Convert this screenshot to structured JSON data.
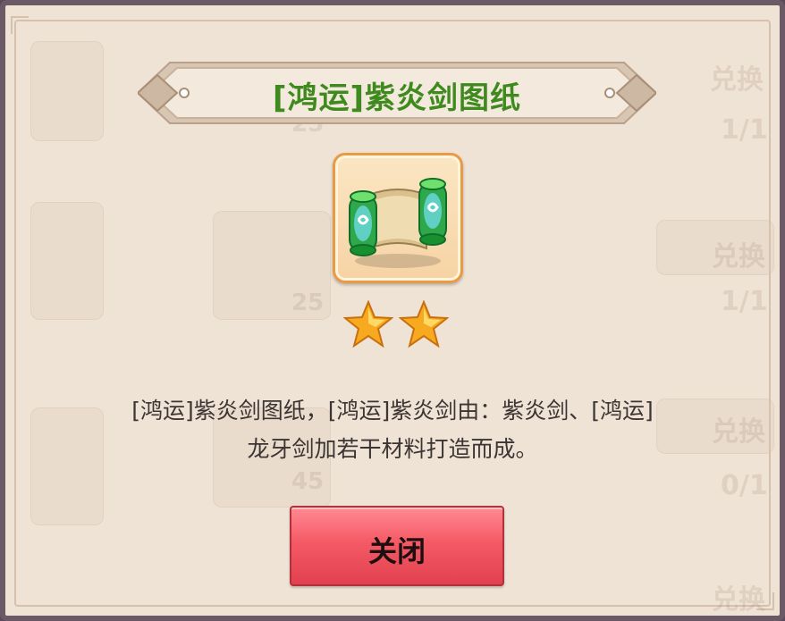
{
  "dialog": {
    "title": "[鸿运]紫炎剑图纸",
    "stars": 2,
    "description_line1": "[鸿运]紫炎剑图纸，[鸿运]紫炎剑由：紫炎剑、[鸿运]",
    "description_line2": "龙牙剑加若干材料打造而成。",
    "close_label": "关闭"
  },
  "background": {
    "exchange_labels": [
      "兑换",
      "兑换",
      "兑换",
      "兑换"
    ],
    "counts": [
      "1/1",
      "1/1",
      "0/1"
    ],
    "numbers": [
      "25",
      "25",
      "45"
    ]
  },
  "colors": {
    "title": "#3f8a1e",
    "button": "#f45a65",
    "panel": "#efe3d6",
    "frame": "#6b5a66"
  },
  "icons": {
    "item": "green-blueprint-scroll-icon",
    "rating": "gold-star-icon"
  }
}
